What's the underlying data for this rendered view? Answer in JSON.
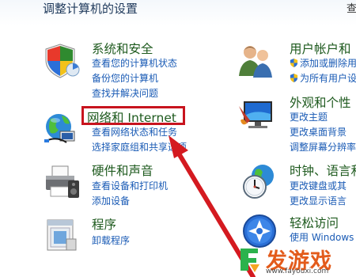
{
  "header": {
    "title": "调整计算机的设置",
    "corner": "查"
  },
  "categories": [
    {
      "title": "系统和安全",
      "links": [
        "查看您的计算机状态",
        "备份您的计算机",
        "查找并解决问题"
      ]
    },
    {
      "title": "网络和 Internet",
      "links": [
        "查看网络状态和任务",
        "选择家庭组和共享选项"
      ]
    },
    {
      "title": "硬件和声音",
      "links": [
        "查看设备和打印机",
        "添加设备"
      ]
    },
    {
      "title": "程序",
      "links": [
        "卸载程序"
      ]
    },
    {
      "title": "用户帐户和",
      "links": [
        "添加或删除用",
        "为所有用户设"
      ]
    },
    {
      "title": "外观和个性",
      "links": [
        "更改主题",
        "更改桌面背景",
        "调整屏幕分辨率"
      ]
    },
    {
      "title": "时钟、语言和",
      "links": [
        "更改键盘或其",
        "更改显示语言"
      ]
    },
    {
      "title": "轻松访问",
      "links": [
        "使用 Windows"
      ]
    }
  ],
  "watermark": {
    "title": "发游戏",
    "url": "www.fayouxi.com"
  },
  "colors": {
    "category_title": "#1e5a1e",
    "link": "#1a5bb5",
    "highlight": "#c8141e",
    "watermark": "#e35b1b"
  }
}
